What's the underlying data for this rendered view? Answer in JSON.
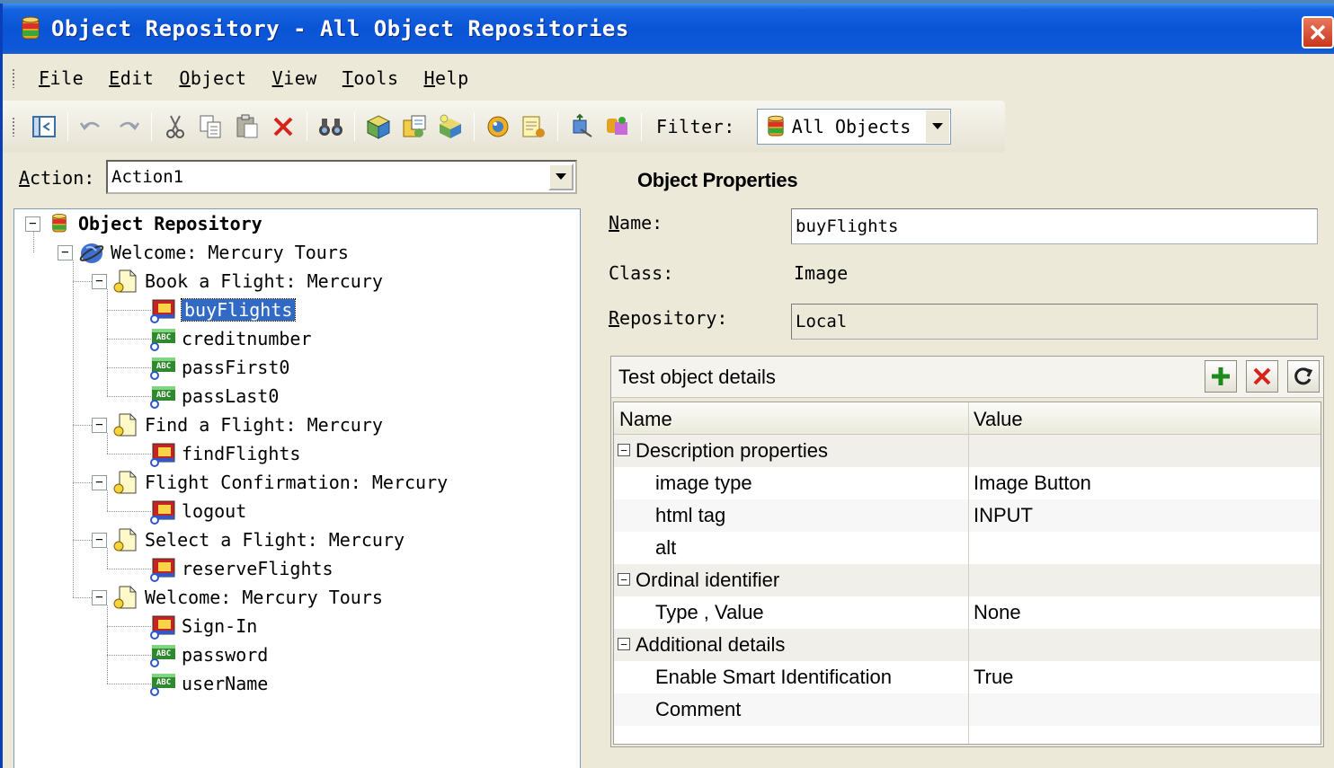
{
  "window": {
    "title": "Object Repository - All Object Repositories"
  },
  "menu": {
    "items": [
      {
        "label": "File",
        "accel": "F"
      },
      {
        "label": "Edit",
        "accel": "E"
      },
      {
        "label": "Object",
        "accel": "O"
      },
      {
        "label": "View",
        "accel": "V"
      },
      {
        "label": "Tools",
        "accel": "T"
      },
      {
        "label": "Help",
        "accel": "H"
      }
    ]
  },
  "toolbar": {
    "filter_label": "Filter:",
    "filter_value": "All Objects"
  },
  "action": {
    "label": "Action:",
    "value": "Action1"
  },
  "tree": {
    "root": "Object Repository",
    "browser": "Welcome: Mercury Tours",
    "pages": [
      {
        "label": "Book a Flight: Mercury",
        "children": [
          {
            "label": "buyFlights",
            "type": "image",
            "selected": true
          },
          {
            "label": "creditnumber",
            "type": "edit"
          },
          {
            "label": "passFirst0",
            "type": "edit"
          },
          {
            "label": "passLast0",
            "type": "edit"
          }
        ]
      },
      {
        "label": "Find a Flight: Mercury",
        "children": [
          {
            "label": "findFlights",
            "type": "image"
          }
        ]
      },
      {
        "label": "Flight Confirmation: Mercury",
        "children": [
          {
            "label": "logout",
            "type": "image"
          }
        ]
      },
      {
        "label": "Select a Flight: Mercury",
        "children": [
          {
            "label": "reserveFlights",
            "type": "image"
          }
        ]
      },
      {
        "label": "Welcome: Mercury Tours",
        "children": [
          {
            "label": "Sign-In",
            "type": "image"
          },
          {
            "label": "password",
            "type": "edit"
          },
          {
            "label": "userName",
            "type": "edit"
          }
        ]
      }
    ]
  },
  "properties": {
    "title": "Object Properties",
    "name_label": "Name:",
    "name_value": "buyFlights",
    "class_label": "Class:",
    "class_value": "Image",
    "repository_label": "Repository:",
    "repository_value": "Local"
  },
  "details": {
    "title": "Test object details",
    "columns": [
      "Name",
      "Value"
    ],
    "rows": [
      {
        "kind": "category",
        "name": "Description properties",
        "value": ""
      },
      {
        "kind": "item",
        "name": "image type",
        "value": "Image Button"
      },
      {
        "kind": "item",
        "name": "html tag",
        "value": "INPUT"
      },
      {
        "kind": "item",
        "name": "alt",
        "value": ""
      },
      {
        "kind": "category",
        "name": "Ordinal identifier",
        "value": ""
      },
      {
        "kind": "item",
        "name": "Type , Value",
        "value": "None"
      },
      {
        "kind": "category",
        "name": "Additional details",
        "value": ""
      },
      {
        "kind": "item",
        "name": "Enable Smart Identification",
        "value": "True"
      },
      {
        "kind": "item",
        "name": "Comment",
        "value": ""
      }
    ]
  },
  "colors": {
    "titlebar": "#0a54d6",
    "selection": "#316ac5",
    "window_bg": "#ece9d8"
  }
}
